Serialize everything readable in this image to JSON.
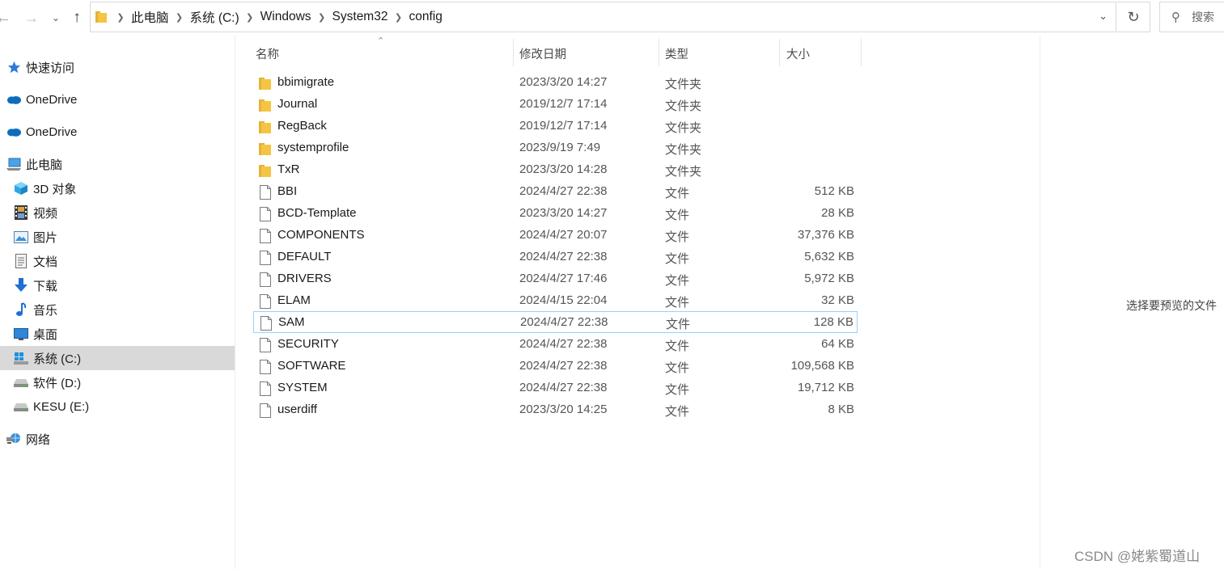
{
  "address_bar": {
    "breadcrumbs": [
      "此电脑",
      "系统 (C:)",
      "Windows",
      "System32",
      "config"
    ],
    "search_placeholder": "搜索"
  },
  "sidebar": {
    "items": [
      {
        "label": "快速访问",
        "icon": "star-icon"
      },
      {
        "label": "OneDrive",
        "icon": "cloud-icon"
      },
      {
        "label": "OneDrive",
        "icon": "cloud-icon"
      },
      {
        "label": "此电脑",
        "icon": "computer-icon"
      },
      {
        "label": "3D 对象",
        "icon": "cube-icon"
      },
      {
        "label": "视频",
        "icon": "film-icon"
      },
      {
        "label": "图片",
        "icon": "picture-icon"
      },
      {
        "label": "文档",
        "icon": "document-icon"
      },
      {
        "label": "下载",
        "icon": "download-arrow-icon"
      },
      {
        "label": "音乐",
        "icon": "music-note-icon"
      },
      {
        "label": "桌面",
        "icon": "desktop-icon"
      },
      {
        "label": "系统 (C:)",
        "icon": "windows-drive-icon"
      },
      {
        "label": "软件 (D:)",
        "icon": "drive-icon"
      },
      {
        "label": "KESU (E:)",
        "icon": "drive-icon"
      },
      {
        "label": "网络",
        "icon": "network-icon"
      }
    ]
  },
  "columns": {
    "name": "名称",
    "date": "修改日期",
    "type": "类型",
    "size": "大小"
  },
  "files": [
    {
      "name": "bbimigrate",
      "date": "2023/3/20 14:27",
      "type": "文件夹",
      "size": "",
      "icon": "folder-icon"
    },
    {
      "name": "Journal",
      "date": "2019/12/7 17:14",
      "type": "文件夹",
      "size": "",
      "icon": "folder-icon"
    },
    {
      "name": "RegBack",
      "date": "2019/12/7 17:14",
      "type": "文件夹",
      "size": "",
      "icon": "folder-icon"
    },
    {
      "name": "systemprofile",
      "date": "2023/9/19 7:49",
      "type": "文件夹",
      "size": "",
      "icon": "folder-icon"
    },
    {
      "name": "TxR",
      "date": "2023/3/20 14:28",
      "type": "文件夹",
      "size": "",
      "icon": "folder-icon"
    },
    {
      "name": "BBI",
      "date": "2024/4/27 22:38",
      "type": "文件",
      "size": "512 KB",
      "icon": "file-icon"
    },
    {
      "name": "BCD-Template",
      "date": "2023/3/20 14:27",
      "type": "文件",
      "size": "28 KB",
      "icon": "file-icon"
    },
    {
      "name": "COMPONENTS",
      "date": "2024/4/27 20:07",
      "type": "文件",
      "size": "37,376 KB",
      "icon": "file-icon"
    },
    {
      "name": "DEFAULT",
      "date": "2024/4/27 22:38",
      "type": "文件",
      "size": "5,632 KB",
      "icon": "file-icon"
    },
    {
      "name": "DRIVERS",
      "date": "2024/4/27 17:46",
      "type": "文件",
      "size": "5,972 KB",
      "icon": "file-icon"
    },
    {
      "name": "ELAM",
      "date": "2024/4/15 22:04",
      "type": "文件",
      "size": "32 KB",
      "icon": "file-icon"
    },
    {
      "name": "SAM",
      "date": "2024/4/27 22:38",
      "type": "文件",
      "size": "128 KB",
      "icon": "file-icon"
    },
    {
      "name": "SECURITY",
      "date": "2024/4/27 22:38",
      "type": "文件",
      "size": "64 KB",
      "icon": "file-icon"
    },
    {
      "name": "SOFTWARE",
      "date": "2024/4/27 22:38",
      "type": "文件",
      "size": "109,568 KB",
      "icon": "file-icon"
    },
    {
      "name": "SYSTEM",
      "date": "2024/4/27 22:38",
      "type": "文件",
      "size": "19,712 KB",
      "icon": "file-icon"
    },
    {
      "name": "userdiff",
      "date": "2023/3/20 14:25",
      "type": "文件",
      "size": "8 KB",
      "icon": "file-icon"
    }
  ],
  "preview": {
    "message": "选择要预览的文件"
  },
  "watermark": "CSDN @姥紫蜀道山",
  "colors": {
    "folder": "#f4c542",
    "selection_border": "#99d1ff",
    "sidebar_selected": "#d9d9d9",
    "onedrive": "#0f6cbd"
  }
}
